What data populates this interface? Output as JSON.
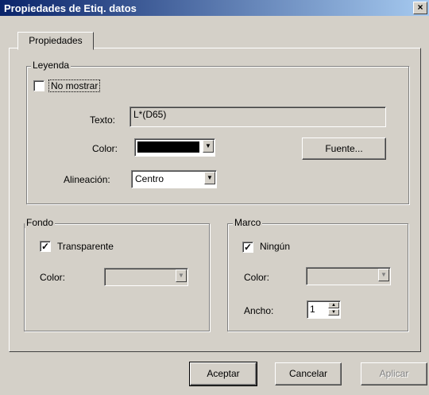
{
  "window": {
    "title": "Propiedades de Etiq. datos",
    "close_glyph": "×"
  },
  "tabs": [
    {
      "label": "Propiedades"
    }
  ],
  "leyenda": {
    "legend": "Leyenda",
    "no_mostrar_label": "No mostrar",
    "no_mostrar_checked": false,
    "texto_label": "Texto:",
    "texto_value": "L*(D65)",
    "color_label": "Color:",
    "color_value": "#000000",
    "fuente_button": "Fuente...",
    "alineacion_label": "Alineación:",
    "alineacion_value": "Centro"
  },
  "fondo": {
    "legend": "Fondo",
    "transparente_label": "Transparente",
    "transparente_checked": true,
    "color_label": "Color:"
  },
  "marco": {
    "legend": "Marco",
    "ningun_label": "Ningún",
    "ningun_checked": true,
    "color_label": "Color:",
    "ancho_label": "Ancho:",
    "ancho_value": "1"
  },
  "buttons": {
    "aceptar": "Aceptar",
    "cancelar": "Cancelar",
    "aplicar": "Aplicar"
  },
  "glyphs": {
    "check": "✓",
    "down_arrow": "▼",
    "up_arrow": "▲"
  }
}
